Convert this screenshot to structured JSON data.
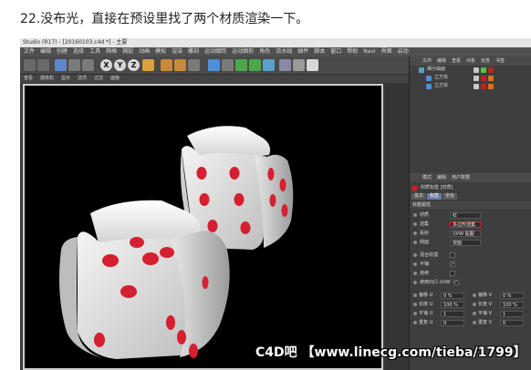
{
  "caption": "22.没布光，直接在预设里找了两个材质渲染一下。",
  "window": {
    "title": "Studio (R17) - [20160103.c4d *] - 主要"
  },
  "menubar": [
    "文件",
    "编辑",
    "创建",
    "选择",
    "工具",
    "网格",
    "捕捉",
    "动画",
    "模拟",
    "渲染",
    "雕刻",
    "运动跟踪",
    "运动图形",
    "角色",
    "流水线",
    "插件",
    "脚本",
    "窗口",
    "帮助",
    "Navi",
    "界面",
    "启动"
  ],
  "toolbar": {
    "letters": [
      "X",
      "Y",
      "Z"
    ],
    "icons": [
      "undo-icon",
      "redo-icon",
      "live-select-icon",
      "move-icon",
      "scale-icon",
      "rotate-icon",
      "render-region-icon",
      "render-view-icon",
      "render-settings-icon",
      "cube-icon",
      "pen-icon",
      "subdivision-icon",
      "cloner-icon",
      "deformer-icon",
      "environment-icon",
      "camera-icon",
      "light-icon"
    ]
  },
  "viewport_menu": [
    "查看",
    "摄像机",
    "显示",
    "选项",
    "过滤",
    "面板"
  ],
  "object_manager": {
    "tabs": [
      "文件",
      "编辑",
      "查看",
      "对象",
      "标签",
      "书签"
    ],
    "rows": [
      {
        "name": "细分曲面",
        "tags": [
          "#c8c8c8",
          "#56c04a",
          "#c02020"
        ]
      },
      {
        "name": "立方体",
        "tags": [
          "#c8c8c8",
          "#c02020",
          "#d87020"
        ]
      },
      {
        "name": "立方体",
        "tags": [
          "#c8c8c8",
          "#c02020",
          "#d87020"
        ]
      }
    ]
  },
  "attribute_manager": {
    "tabs": [
      "模式",
      "编辑",
      "用户数据"
    ],
    "header": "材质标签 [材质]",
    "subtabs": [
      "基本",
      "标签",
      "坐标"
    ],
    "active_subtab": 1,
    "section": "标签属性",
    "props": [
      {
        "label": "材质",
        "value": "红"
      },
      {
        "label": "选集",
        "value": "多边形选集"
      },
      {
        "label": "投射",
        "value": "UVW 贴图"
      },
      {
        "label": "侧面",
        "value": "双面"
      }
    ],
    "checks": [
      {
        "label": "混合纹理",
        "on": false
      },
      {
        "label": "平铺",
        "on": true
      },
      {
        "label": "连续",
        "on": false
      },
      {
        "label": "使用凹凸 UVW",
        "on": true
      }
    ],
    "pairs": [
      [
        {
          "label": "偏移 U",
          "value": "0 %"
        },
        {
          "label": "偏移 V",
          "value": "0 %"
        }
      ],
      [
        {
          "label": "长度 U",
          "value": "100 %"
        },
        {
          "label": "长度 V",
          "value": "100 %"
        }
      ],
      [
        {
          "label": "平铺 U",
          "value": "1"
        },
        {
          "label": "平铺 V",
          "value": "1"
        }
      ],
      [
        {
          "label": "重复 U",
          "value": "0"
        },
        {
          "label": "重复 V",
          "value": "0"
        }
      ]
    ]
  },
  "watermark": "C4D吧 【www.linecg.com/tieba/1799】",
  "colors": {
    "viewport_bg": "#000000",
    "dice_body": "#e2e2e2",
    "dice_pip": "#d42030",
    "panel_bg": "#3e3e3e",
    "highlight": "#e02020"
  }
}
